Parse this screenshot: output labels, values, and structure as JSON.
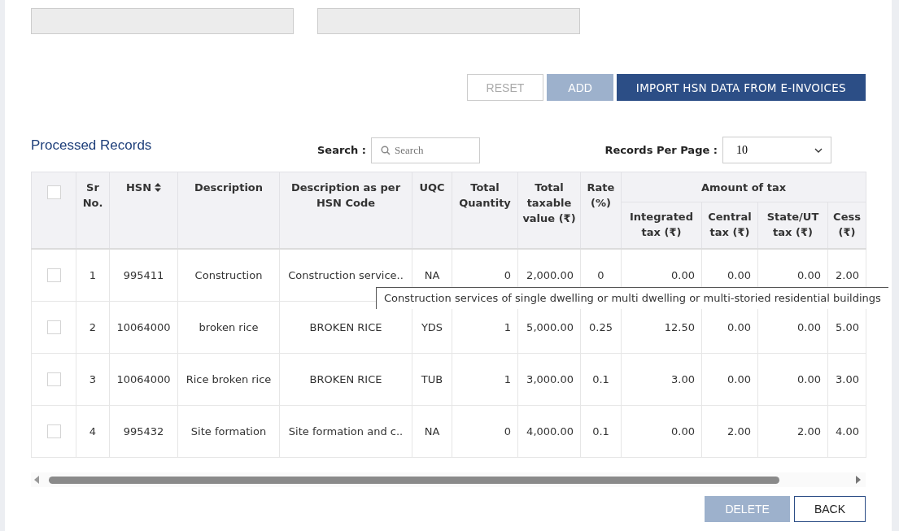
{
  "fields": [
    {
      "disabled": true
    },
    {
      "disabled": true
    }
  ],
  "action_buttons": [
    {
      "label": "RESET",
      "kind": "outline",
      "disabled": true
    },
    {
      "label": "ADD",
      "kind": "filled",
      "disabled": true
    },
    {
      "label": "IMPORT HSN DATA FROM E-INVOICES",
      "kind": "filled",
      "disabled": false
    }
  ],
  "section_title": "Processed Records",
  "search": {
    "label": "Search :",
    "placeholder": "Search"
  },
  "records_per_page": {
    "label": "Records Per Page :",
    "value": "10"
  },
  "table": {
    "select_all": {
      "checked": false
    },
    "columns": [
      {
        "label": "Sr No."
      },
      {
        "label": "HSN",
        "sortable": true
      },
      {
        "label": "Description"
      },
      {
        "label": "Description as per HSN Code"
      },
      {
        "label": "UQC"
      },
      {
        "label": "Total Quantity"
      },
      {
        "label": "Total taxable value (₹)"
      },
      {
        "label": "Rate (%)"
      }
    ],
    "group_header": "Amount of tax",
    "sub_columns": [
      "Integrated tax (₹)",
      "Central tax (₹)",
      "State/UT tax (₹)",
      "Cess (₹)"
    ],
    "rows": [
      {
        "checked": false,
        "cells": [
          "1",
          "995411",
          "Construction",
          "Construction service..",
          "NA",
          "0",
          "2,000.00",
          "0",
          "0.00",
          "0.00",
          "0.00",
          "2.00"
        ]
      },
      {
        "checked": false,
        "cells": [
          "2",
          "10064000",
          "broken rice",
          "BROKEN RICE",
          "YDS",
          "1",
          "5,000.00",
          "0.25",
          "12.50",
          "0.00",
          "0.00",
          "5.00"
        ]
      },
      {
        "checked": false,
        "cells": [
          "3",
          "10064000",
          "Rice broken rice",
          "BROKEN RICE",
          "TUB",
          "1",
          "3,000.00",
          "0.1",
          "3.00",
          "0.00",
          "0.00",
          "3.00"
        ]
      },
      {
        "checked": false,
        "cells": [
          "4",
          "995432",
          "Site formation",
          "Site formation and c..",
          "NA",
          "0",
          "4,000.00",
          "0.1",
          "0.00",
          "2.00",
          "2.00",
          "4.00"
        ]
      }
    ]
  },
  "tooltip": "Construction services of single dwelling or multi dwelling or multi-storied residential buildings",
  "bottom_buttons": [
    {
      "label": "DELETE",
      "kind": "filled",
      "disabled": true
    },
    {
      "label": "BACK",
      "kind": "outline",
      "disabled": false
    }
  ]
}
